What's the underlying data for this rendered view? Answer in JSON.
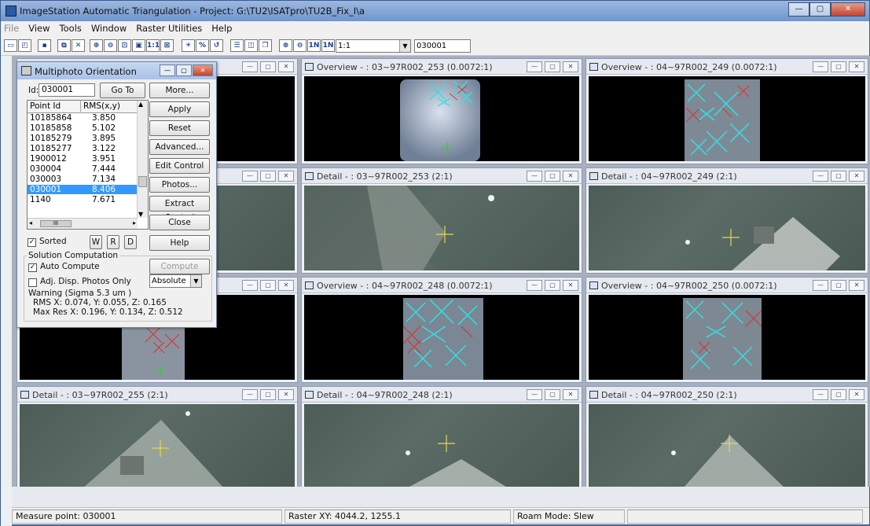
{
  "window": {
    "title": "ImageStation Automatic Triangulation - Project: G:\\TU2\\ISATpro\\TU2B_Fix_I\\a",
    "buttons": {
      "minimize": "—",
      "maximize": "▢",
      "close": "✕"
    }
  },
  "menu": {
    "items": [
      "File",
      "View",
      "Tools",
      "Window",
      "Raster Utilities",
      "Help"
    ],
    "disabled": [
      "File"
    ]
  },
  "toolbar": {
    "zoom_value": "1:1",
    "id_value": "030001",
    "icons": [
      "new-icon",
      "open-icon",
      "save-icon",
      "copy-icon",
      "delete-icon",
      "zoom-in-icon",
      "zoom-out-icon",
      "zoom-window-icon",
      "fit-icon",
      "one-to-one-icon",
      "window-icon",
      "bright-icon",
      "contrast-icon",
      "roam-icon",
      "tile-horizontal-icon",
      "tile-vertical-icon",
      "cascade-icon",
      "zoom-in2-icon",
      "zoom-out2-icon",
      "one-to-n-icon",
      "one-to-n2-icon"
    ]
  },
  "panes": [
    {
      "label": "",
      "type": "overview"
    },
    {
      "label": "Overview - : 03~97R002_253  (0.0072:1)",
      "type": "overview"
    },
    {
      "label": "Overview - : 04~97R002_249  (0.0072:1)",
      "type": "overview"
    },
    {
      "label": "",
      "type": "detail"
    },
    {
      "label": "Detail - : 03~97R002_253  (2:1)",
      "type": "detail"
    },
    {
      "label": "Detail - : 04~97R002_249  (2:1)",
      "type": "detail"
    },
    {
      "label": "",
      "type": "overview"
    },
    {
      "label": "Overview - : 04~97R002_248  (0.0072:1)",
      "type": "overview"
    },
    {
      "label": "Overview - : 04~97R002_250  (0.0072:1)",
      "type": "overview"
    },
    {
      "label": "Detail - : 03~97R002_255  (2:1)",
      "type": "detail"
    },
    {
      "label": "Detail - : 04~97R002_248  (2:1)",
      "type": "detail"
    },
    {
      "label": "Detail - : 04~97R002_250  (2:1)",
      "type": "detail"
    }
  ],
  "dialog": {
    "title": "Multiphoto Orientation",
    "id_label": "Id:",
    "id_value": "030001",
    "goto_label": "Go To",
    "columns": [
      "Point Id",
      "RMS(x,y)"
    ],
    "rows": [
      {
        "id": "10185864",
        "rms": "3.850"
      },
      {
        "id": "10185858",
        "rms": "5.102"
      },
      {
        "id": "10185279",
        "rms": "3.895"
      },
      {
        "id": "10185277",
        "rms": "3.122"
      },
      {
        "id": "1900012",
        "rms": "3.951"
      },
      {
        "id": "030004",
        "rms": "7.444"
      },
      {
        "id": "030003",
        "rms": "7.134"
      },
      {
        "id": "030001",
        "rms": "8.406"
      },
      {
        "id": "1140",
        "rms": "7.671"
      }
    ],
    "selected_index": 7,
    "buttons": [
      "More...",
      "Apply",
      "Reset",
      "Advanced...",
      "Edit Control",
      "Photos...",
      "Extract Control",
      "Close",
      "Help"
    ],
    "sorted_label": "Sorted",
    "sort_buttons": [
      "W",
      "R",
      "D"
    ],
    "solution_group": "Solution Computation",
    "auto_compute": "Auto Compute",
    "compute_label": "Compute",
    "adj_disp": "Adj. Disp. Photos Only",
    "mode_value": "Absolute",
    "warning": "Warning  (Sigma 5.3 um )",
    "rms_line": "RMS X: 0.074,  Y: 0.055,  Z: 0.165",
    "maxres_line": "Max Res X: 0.196,  Y: 0.134,  Z: 0.512",
    "scroll_label": "III"
  },
  "status": {
    "measure": "Measure point: 030001",
    "raster": "Raster XY: 4044.2, 1255.1",
    "roam": "Roam Mode: Slew"
  }
}
